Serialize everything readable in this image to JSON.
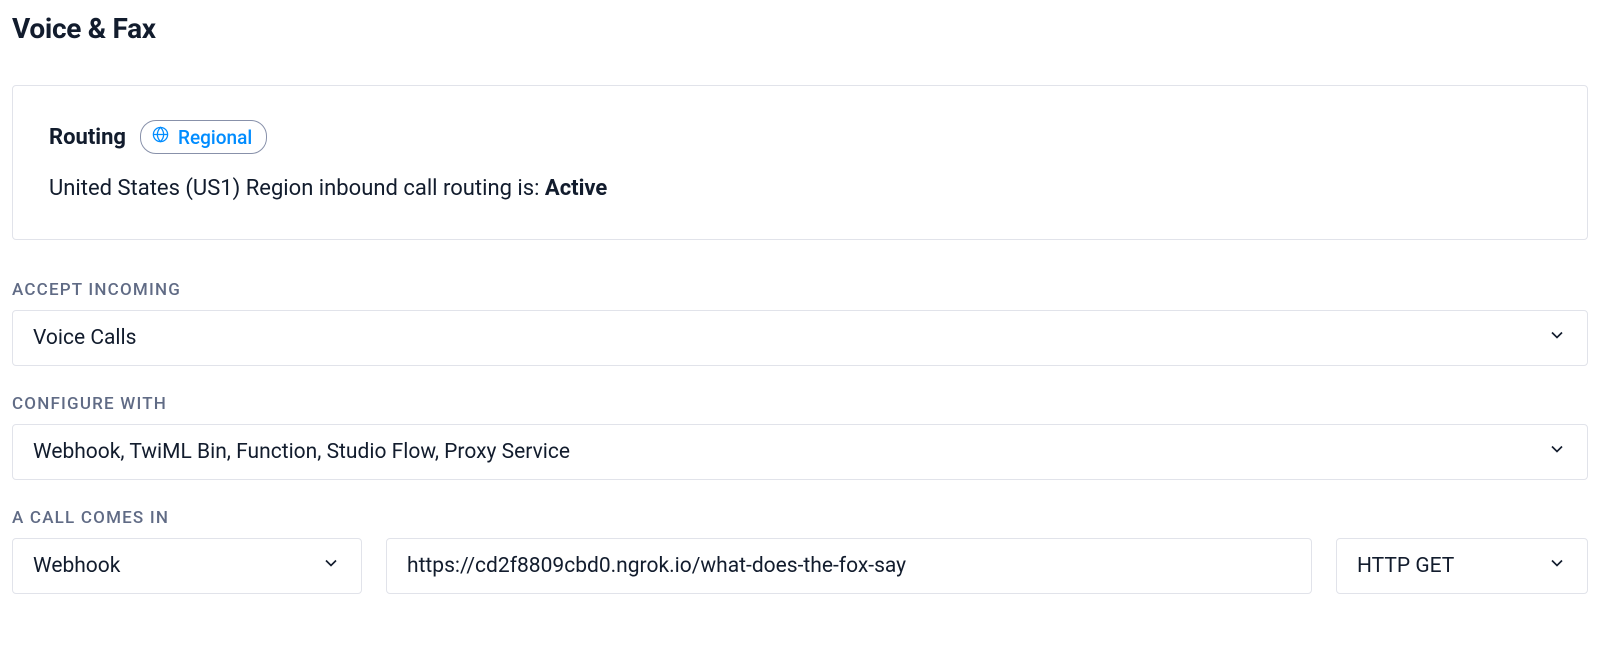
{
  "page": {
    "title": "Voice & Fax"
  },
  "routing": {
    "label": "Routing",
    "badge": "Regional",
    "status_prefix": "United States (US1) Region inbound call routing is: ",
    "status_value": "Active"
  },
  "fields": {
    "accept_incoming": {
      "label": "ACCEPT INCOMING",
      "value": "Voice Calls"
    },
    "configure_with": {
      "label": "CONFIGURE WITH",
      "value": "Webhook, TwiML Bin, Function, Studio Flow, Proxy Service"
    },
    "call_comes_in": {
      "label": "A CALL COMES IN",
      "handler": "Webhook",
      "url": "https://cd2f8809cbd0.ngrok.io/what-does-the-fox-say",
      "method": "HTTP GET"
    }
  }
}
